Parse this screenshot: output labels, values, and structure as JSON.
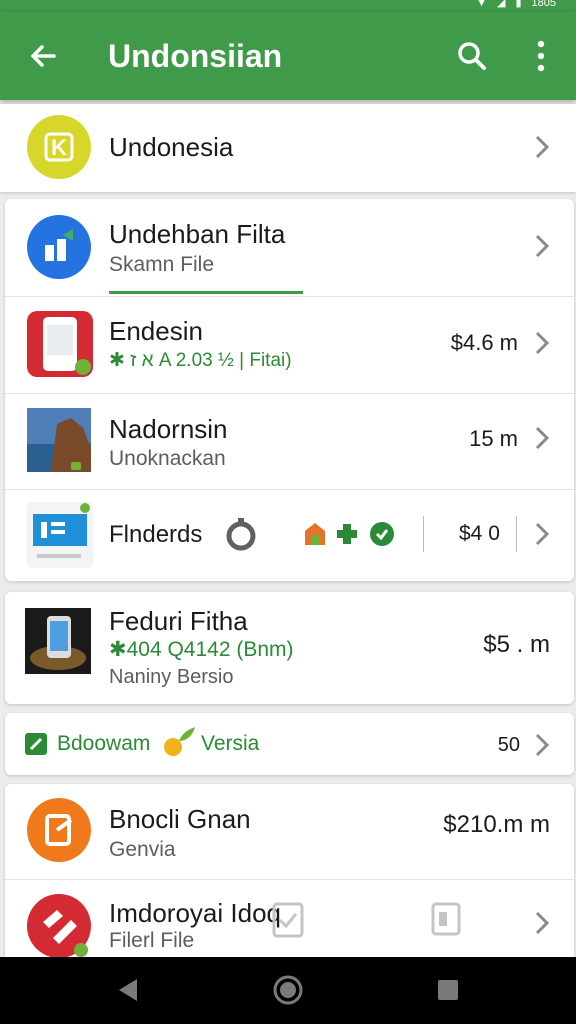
{
  "status": {
    "time": "18:35",
    "time_partial": "1805"
  },
  "appbar": {
    "title": "Undonsiian"
  },
  "rows": [
    {
      "name": "Undonesia"
    },
    {
      "name": "Undehban Filta",
      "sub": "Skamn File"
    },
    {
      "name": "Endesin",
      "sub": "✱ א ז A 2.03 ½ | Fitai)",
      "price": "$4.6 m"
    },
    {
      "name": "Nadornsin",
      "sub": "Unoknackan",
      "price": "15 m"
    },
    {
      "name": "Flnderds",
      "price": "$4 0"
    },
    {
      "name": "Feduri Fitha",
      "sub1": "✱404 Q4142 (Bnm)",
      "sub2": "Naniny Bersio",
      "price": "$5 . m"
    },
    {
      "name_left": "Bdoowam",
      "name_right": "Versia",
      "price": "50"
    },
    {
      "name": "Bnocli Gnan",
      "sub": "Genvia",
      "price": "$210.m m"
    },
    {
      "name": "Imdoroyai Idoq",
      "sub": "Filerl File"
    }
  ],
  "colors": {
    "brand": "#3f9a4a",
    "accent_green": "#2b8a36",
    "yellow": "#d7d62a",
    "blue": "#2573e0",
    "red": "#d42a33",
    "orange": "#f07a1b"
  }
}
